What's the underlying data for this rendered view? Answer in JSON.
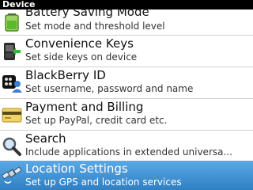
{
  "header": {
    "title": "Device"
  },
  "items": [
    {
      "title": "Battery Saving Mode",
      "subtitle": "Set mode and threshold level",
      "icon": "battery-icon"
    },
    {
      "title": "Convenience Keys",
      "subtitle": "Set side keys on device",
      "icon": "convenience-keys-icon"
    },
    {
      "title": "BlackBerry ID",
      "subtitle": "Set username, password and name",
      "icon": "blackberry-id-icon"
    },
    {
      "title": "Payment and Billing",
      "subtitle": "Set up PayPal, credit card etc.",
      "icon": "credit-card-icon"
    },
    {
      "title": "Search",
      "subtitle": "Include applications in extended universa...",
      "icon": "search-icon"
    },
    {
      "title": "Location Settings",
      "subtitle": "Set up GPS and location services",
      "icon": "satellite-icon",
      "selected": true
    }
  ],
  "colors": {
    "selection": "#3a8fd4",
    "header_bg": "#000000"
  }
}
